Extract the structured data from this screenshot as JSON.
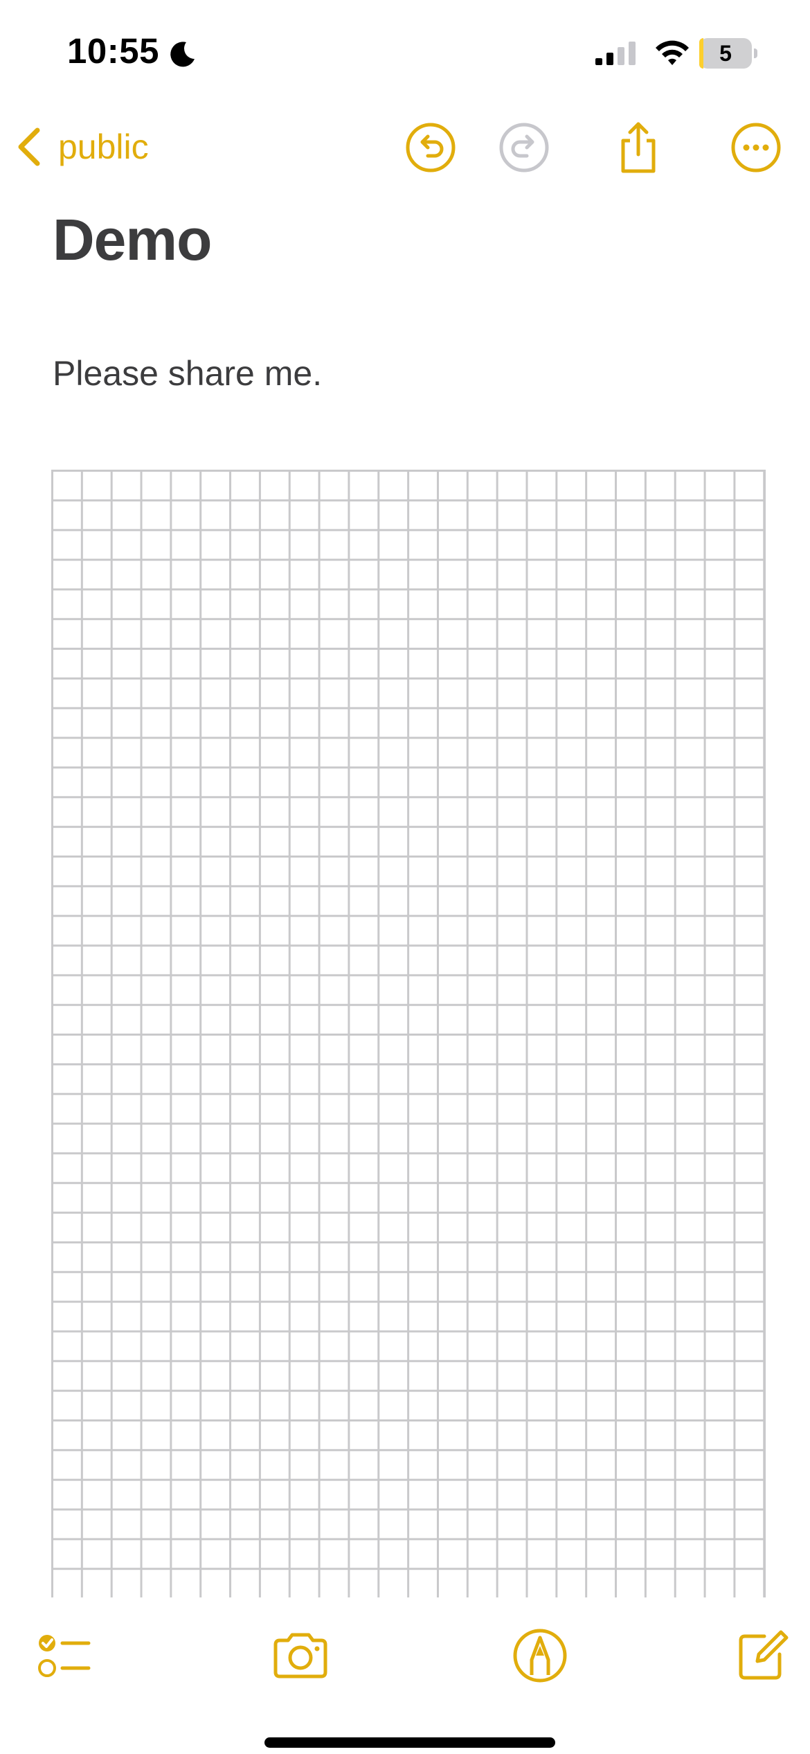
{
  "status_bar": {
    "time": "10:55",
    "battery_percent": "5",
    "battery_level": 0.05,
    "focus_icon": "moon-icon",
    "signal_icon": "cellular-signal-icon",
    "wifi_icon": "wifi-icon"
  },
  "nav": {
    "back_label": "public",
    "back_icon": "chevron-left-icon",
    "undo_icon": "undo-icon",
    "redo_icon": "redo-icon",
    "redo_enabled": false,
    "share_icon": "share-icon",
    "more_icon": "ellipsis-circle-icon"
  },
  "note": {
    "title": "Demo",
    "body": "Please share me."
  },
  "toolbar": {
    "checklist_icon": "checklist-icon",
    "camera_icon": "camera-icon",
    "markup_icon": "markup-pen-icon",
    "compose_icon": "compose-icon"
  },
  "colors": {
    "accent": "#e1ad0c",
    "disabled": "#c7c7cc",
    "text": "#3c3c3e",
    "grid": "#c9c9cb",
    "battery_low": "#fdcf2d"
  }
}
